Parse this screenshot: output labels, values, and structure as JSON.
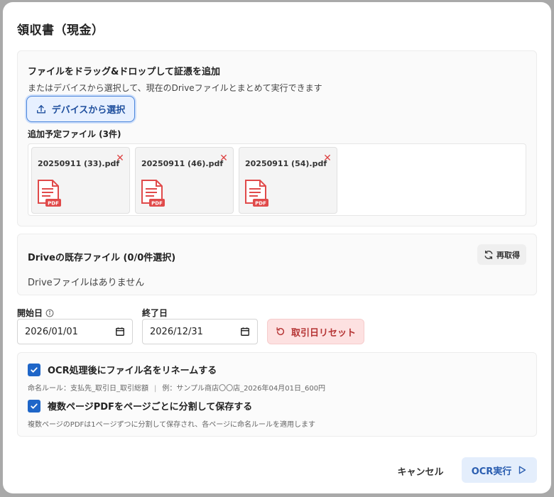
{
  "dialog": {
    "title": "領収書（現金）"
  },
  "upload": {
    "heading": "ファイルをドラッグ&ドロップして証憑を追加",
    "subtext": "またはデバイスから選択して、現在のDriveファイルとまとめて実行できます",
    "select_button": "デバイスから選択",
    "planned_label": "追加予定ファイル (3件)",
    "files": [
      {
        "name": "20250911 (33).pdf",
        "badge": "PDF"
      },
      {
        "name": "20250911 (46).pdf",
        "badge": "PDF"
      },
      {
        "name": "20250911 (54).pdf",
        "badge": "PDF"
      }
    ]
  },
  "drive": {
    "heading": "Driveの既存ファイル (0/0件選択)",
    "refresh_label": "再取得",
    "empty_text": "Driveファイルはありません"
  },
  "dates": {
    "start_label": "開始日",
    "start_value": "2026/01/01",
    "end_label": "終了日",
    "end_value": "2026/12/31",
    "reset_label": "取引日リセット"
  },
  "options": {
    "rename_label": "OCR処理後にファイル名をリネームする",
    "rename_checked": true,
    "rename_hint_rule": "命名ルール：支払先_取引日_取引総額",
    "rename_hint_sep": "|",
    "rename_hint_example": "例：サンプル商店〇〇店_2026年04月01日_600円",
    "split_label": "複数ページPDFをページごとに分割して保存する",
    "split_checked": true,
    "split_hint": "複数ページのPDFは1ページずつに分割して保存され、各ページに命名ルールを適用します"
  },
  "footer": {
    "cancel_label": "キャンセル",
    "run_label": "OCR実行"
  },
  "colors": {
    "accent": "#1f66c8",
    "danger": "#b53434",
    "pdf_red": "#e04a4a"
  }
}
